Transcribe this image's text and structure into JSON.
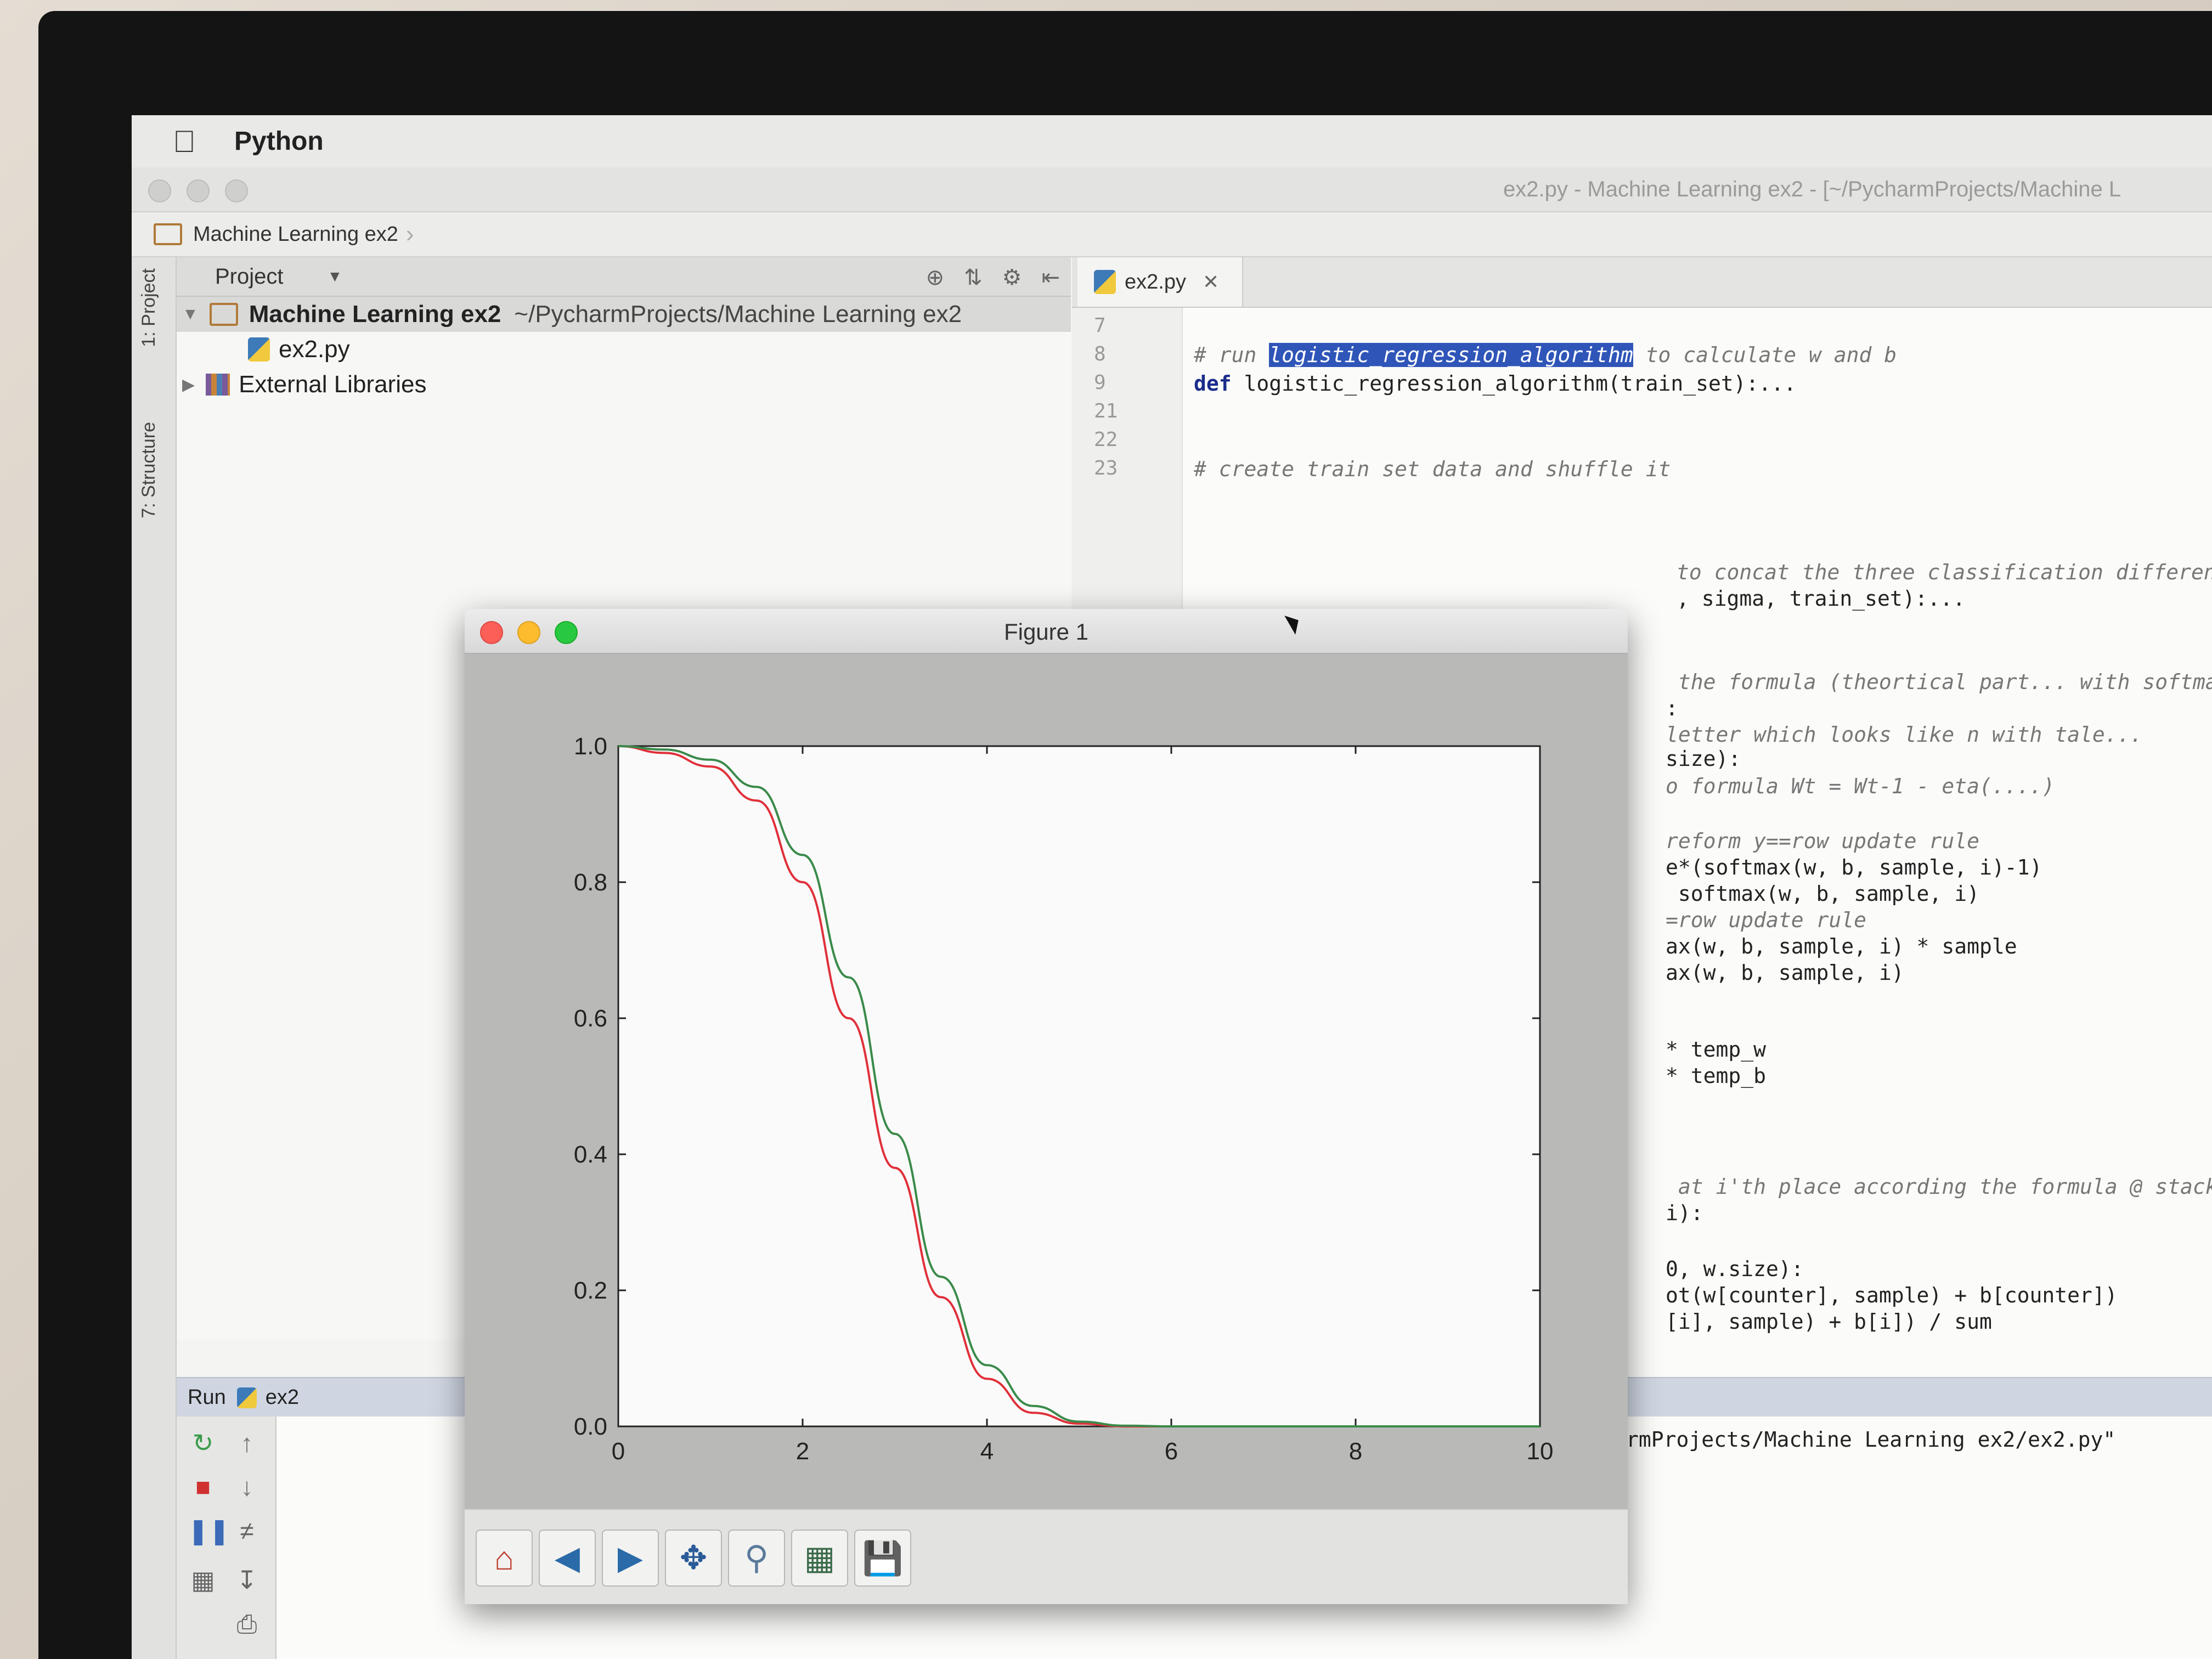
{
  "menubar": {
    "apple_icon": "apple-icon",
    "app_name": "Python"
  },
  "ide": {
    "window_title": "ex2.py - Machine Learning ex2 - [~/PycharmProjects/Machine L",
    "breadcrumb": "Machine Learning ex2",
    "side_tabs": [
      "1: Project",
      "7: Structure"
    ]
  },
  "project_panel": {
    "header": "Project",
    "tree": [
      {
        "label": "Machine Learning ex2",
        "path": "~/PycharmProjects/Machine Learning ex2",
        "type": "folder",
        "expanded": true
      },
      {
        "label": "ex2.py",
        "type": "python-file"
      },
      {
        "label": "External Libraries",
        "type": "library",
        "expanded": false
      }
    ]
  },
  "editor": {
    "tab_label": "ex2.py",
    "line_numbers": [
      "7",
      "8",
      "9",
      "21",
      "22",
      "23"
    ],
    "lines": {
      "l8_pre": "# run ",
      "l8_hl": "logistic_regression_algorithm",
      "l8_post": " to calculate w and b",
      "l9_kw": "def",
      "l9_rest": " logistic_regression_algorithm(train_set):...",
      "l23": "# create train set data and shuffle it",
      "c1": "to concat the three classification different vectors int",
      "c2": ", sigma, train_set):...",
      "c3": " the formula (theortical part... with softmax)",
      "c4": ":",
      "c5": "letter which looks like n with tale...",
      "c6": "size):",
      "c7": "o formula Wt = Wt-1 - eta(....)",
      "c8": "reform y==row update rule",
      "c9": "e*(softmax(w, b, sample, i)-1)",
      "c10": " softmax(w, b, sample, i)",
      "c11": "=row update rule",
      "c12": "ax(w, b, sample, i) * sample",
      "c13": "ax(w, b, sample, i)",
      "c14": "* temp_w",
      "c15": "* temp_b",
      "c16": " at i'th place according the formula @ stackoverfolow",
      "c17": "i):",
      "c18": "0, w.size):",
      "c19": "ot(w[counter], sample) + b[counter])",
      "c20": "[i], sample) + b[i]) / sum"
    }
  },
  "run_panel": {
    "label": "Run",
    "config": "ex2",
    "output": "rmProjects/Machine Learning ex2/ex2.py\""
  },
  "figure_window": {
    "title": "Figure 1",
    "toolbar_icons": [
      "home-icon",
      "back-icon",
      "forward-icon",
      "pan-icon",
      "zoom-icon",
      "configure-subplots-icon",
      "save-icon"
    ]
  },
  "chart_data": {
    "type": "line",
    "title": "",
    "xlabel": "",
    "ylabel": "",
    "xlim": [
      0,
      10
    ],
    "ylim": [
      0.0,
      1.0
    ],
    "xticks": [
      "0",
      "2",
      "4",
      "6",
      "8",
      "10"
    ],
    "yticks": [
      "0.0",
      "0.2",
      "0.4",
      "0.6",
      "0.8",
      "1.0"
    ],
    "grid": false,
    "series": [
      {
        "color": "#e0303a",
        "x": [
          0,
          0.5,
          1.0,
          1.5,
          2.0,
          2.5,
          3.0,
          3.5,
          4.0,
          4.5,
          5.0,
          5.5,
          6.0,
          8.0,
          10.0
        ],
        "y": [
          1.0,
          0.99,
          0.97,
          0.92,
          0.8,
          0.6,
          0.38,
          0.19,
          0.07,
          0.02,
          0.004,
          0.0,
          0.0,
          0.0,
          0.0
        ]
      },
      {
        "color": "#3a8a4a",
        "x": [
          0,
          0.5,
          1.0,
          1.5,
          2.0,
          2.5,
          3.0,
          3.5,
          4.0,
          4.5,
          5.0,
          5.5,
          6.0,
          8.0,
          10.0
        ],
        "y": [
          1.0,
          0.995,
          0.98,
          0.94,
          0.84,
          0.66,
          0.43,
          0.22,
          0.09,
          0.03,
          0.007,
          0.001,
          0.0,
          0.0,
          0.0
        ]
      }
    ]
  }
}
